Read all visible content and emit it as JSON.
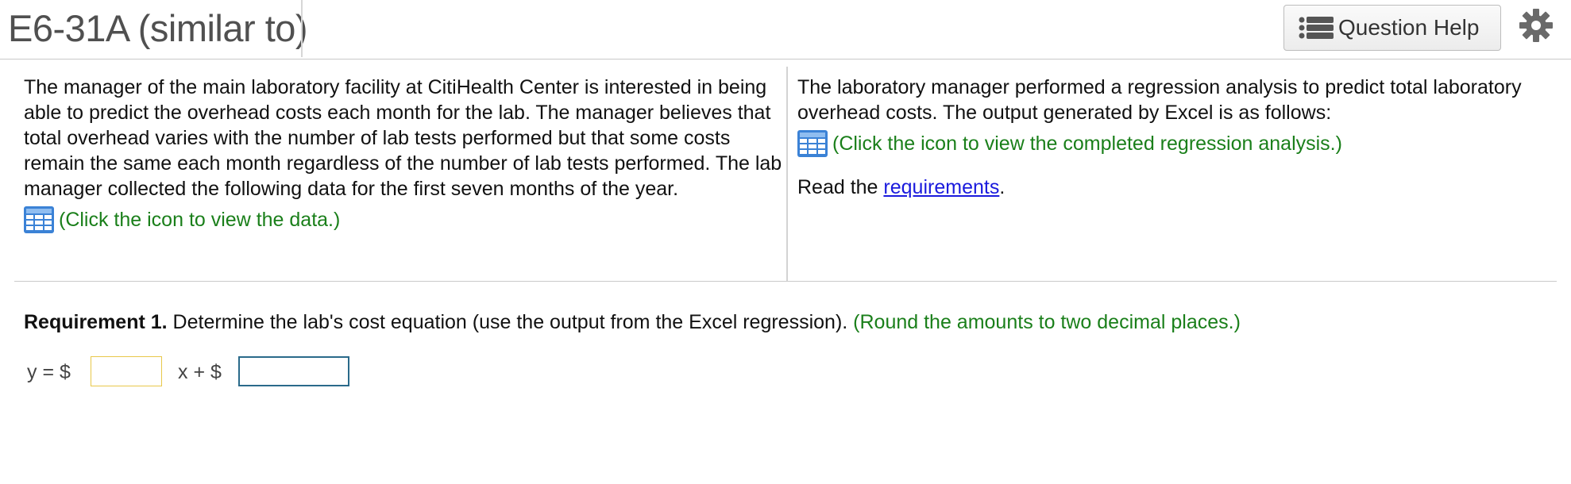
{
  "header": {
    "title": "E6-31A (similar to)",
    "help_button_label": "Question Help"
  },
  "left_panel": {
    "text": "The manager of the main laboratory facility at CitiHealth Center is interested in being able to predict the overhead costs each month for the lab. The manager believes that total overhead varies with the number of lab tests performed but that some costs remain the same each month regardless of the number of lab tests performed. The lab manager collected the following data for the first seven months of the year.",
    "data_link": "(Click the icon to view the data.)"
  },
  "right_panel": {
    "text": "The laboratory manager performed a regression analysis to predict total laboratory overhead costs. The output generated by Excel is as follows:",
    "regression_link": "(Click the icon to view the completed regression analysis.)",
    "read_prefix": "Read the ",
    "requirements_link": "requirements",
    "read_suffix": "."
  },
  "requirement": {
    "label": "Requirement 1.",
    "text": " Determine the lab's cost equation (use the output from the Excel regression).",
    "hint": " (Round the amounts to two decimal places.)"
  },
  "equation": {
    "y_label": "y = $",
    "x_label": "x + $",
    "slope_value": "",
    "intercept_value": ""
  },
  "colors": {
    "accent_green": "#1a7f1a",
    "link_blue": "#1a1add",
    "icon_blue": "#3b82d6"
  }
}
